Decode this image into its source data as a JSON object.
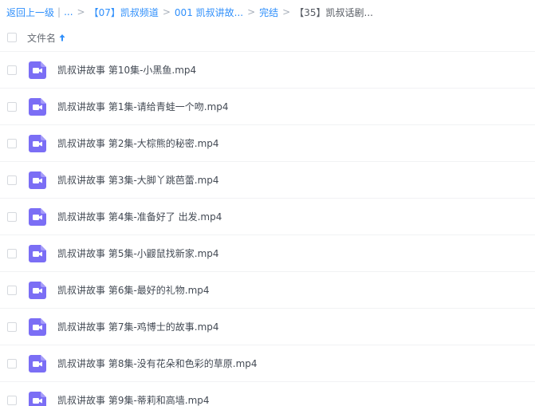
{
  "breadcrumb": {
    "back": "返回上一级",
    "pipe": "|",
    "ellipsis": "...",
    "sep": ">",
    "items": [
      {
        "label": "【07】凯叔频道"
      },
      {
        "label": "001 凯叔讲故..."
      },
      {
        "label": "完结"
      }
    ],
    "current": "【35】凯叔话剧..."
  },
  "header": {
    "column_label": "文件名",
    "sort": "ascending"
  },
  "colors": {
    "link": "#2f8ffb",
    "video_icon": "#7b6ef5"
  },
  "files": [
    {
      "name": "凯叔讲故事 第10集-小黑鱼.mp4",
      "icon": "video-file-icon"
    },
    {
      "name": "凯叔讲故事 第1集-请给青蛙一个吻.mp4",
      "icon": "video-file-icon"
    },
    {
      "name": "凯叔讲故事 第2集-大棕熊的秘密.mp4",
      "icon": "video-file-icon"
    },
    {
      "name": "凯叔讲故事 第3集-大脚丫跳芭蕾.mp4",
      "icon": "video-file-icon"
    },
    {
      "name": "凯叔讲故事 第4集-准备好了 出发.mp4",
      "icon": "video-file-icon"
    },
    {
      "name": "凯叔讲故事 第5集-小鼹鼠找新家.mp4",
      "icon": "video-file-icon"
    },
    {
      "name": "凯叔讲故事 第6集-最好的礼物.mp4",
      "icon": "video-file-icon"
    },
    {
      "name": "凯叔讲故事 第7集-鸡博士的故事.mp4",
      "icon": "video-file-icon"
    },
    {
      "name": "凯叔讲故事 第8集-没有花朵和色彩的草原.mp4",
      "icon": "video-file-icon"
    },
    {
      "name": "凯叔讲故事 第9集-蒂莉和高墙.mp4",
      "icon": "video-file-icon"
    }
  ]
}
